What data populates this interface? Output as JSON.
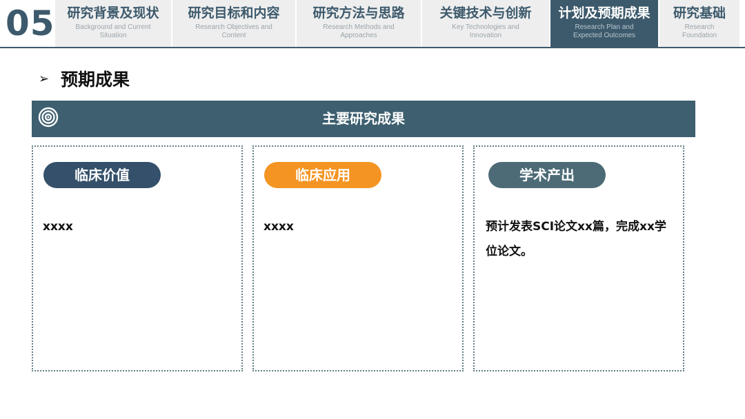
{
  "header": {
    "section_number": "05",
    "tabs": [
      {
        "cn": "研究背景及现状",
        "en": "Background and Current Situation",
        "active": false
      },
      {
        "cn": "研究目标和内容",
        "en": "Research Objectives and Content",
        "active": false
      },
      {
        "cn": "研究方法与思路",
        "en": "Research Methods and Approaches",
        "active": false
      },
      {
        "cn": "关键技术与创新",
        "en": "Key Technologies and Innovation",
        "active": false
      },
      {
        "cn": "计划及预期成果",
        "en": "Research Plan and Expected Outcomes",
        "active": true
      },
      {
        "cn": "研究基础",
        "en": "Research Foundation",
        "active": false
      }
    ]
  },
  "heading": {
    "arrow": "➢",
    "title": "预期成果"
  },
  "banner": {
    "title": "主要研究成果",
    "icon": "target-icon"
  },
  "cards": [
    {
      "label": "临床价值",
      "color": "#34506a",
      "text": "xxxx"
    },
    {
      "label": "临床应用",
      "color": "#f49423",
      "text": "xxxx"
    },
    {
      "label": "学术产出",
      "color": "#4d6b77",
      "text": "预计发表SCI论文xx篇，完成xx学位论文。"
    }
  ],
  "colors": {
    "primary": "#3d5a6c",
    "accent": "#f49423"
  }
}
